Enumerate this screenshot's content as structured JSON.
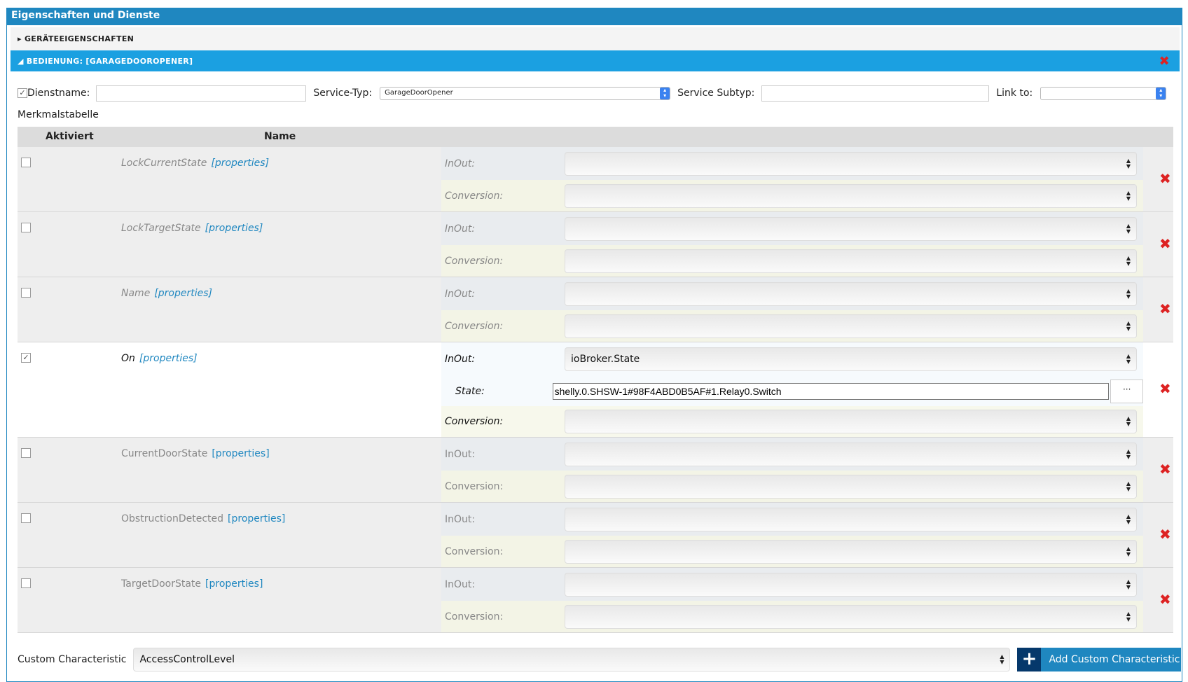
{
  "header": {
    "title": "Eigenschaften und Dienste"
  },
  "accordion": {
    "device_props": "GERÄTEEIGENSCHAFTEN",
    "service": "BEDIENUNG: [GARAGEDOOROPENER]"
  },
  "form": {
    "service_name_label": "Dienstname:",
    "service_name_value": "",
    "service_name_checked": true,
    "service_type_label": "Service-Typ:",
    "service_type_value": "GarageDoorOpener",
    "subtype_label": "Service Subtyp:",
    "subtype_value": "",
    "link_label": "Link to:",
    "link_value": ""
  },
  "table": {
    "title": "Merkmalstabelle",
    "col_active": "Aktiviert",
    "col_name": "Name",
    "properties_link": "[properties]",
    "inout_label": "InOut:",
    "conversion_label": "Conversion:",
    "state_label": "State:",
    "dots_label": "···",
    "rows": [
      {
        "name": "LockCurrentState",
        "checked": false,
        "italic": true,
        "inout": "",
        "conversion": ""
      },
      {
        "name": "LockTargetState",
        "checked": false,
        "italic": true,
        "inout": "",
        "conversion": ""
      },
      {
        "name": "Name",
        "checked": false,
        "italic": true,
        "inout": "",
        "conversion": ""
      },
      {
        "name": "On",
        "checked": true,
        "italic": true,
        "inout": "ioBroker.State",
        "state": "shelly.0.SHSW-1#98F4ABD0B5AF#1.Relay0.Switch",
        "conversion": ""
      },
      {
        "name": "CurrentDoorState",
        "checked": false,
        "italic": false,
        "inout": "",
        "conversion": ""
      },
      {
        "name": "ObstructionDetected",
        "checked": false,
        "italic": false,
        "inout": "",
        "conversion": ""
      },
      {
        "name": "TargetDoorState",
        "checked": false,
        "italic": false,
        "inout": "",
        "conversion": ""
      }
    ]
  },
  "custom": {
    "label": "Custom Characteristic",
    "selected": "AccessControlLevel",
    "add_button": "Add Custom Characteristic"
  }
}
